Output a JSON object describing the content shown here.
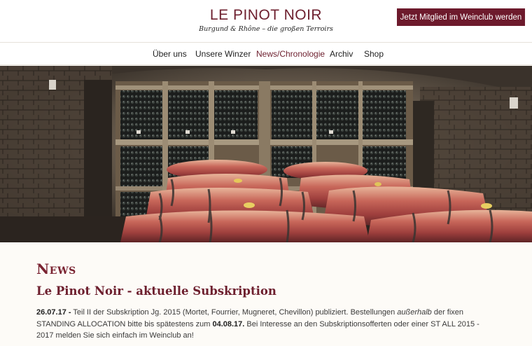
{
  "brand": {
    "title": "LE PINOT NOIR",
    "subtitle": "Burgund & Rhône – die großen Terroirs"
  },
  "header": {
    "cta_label": "Jetzt Mitglied im Weinclub werden"
  },
  "nav": {
    "items": [
      {
        "label": "Über uns"
      },
      {
        "label": "Unsere Winzer"
      },
      {
        "label": "News/Chronologie",
        "active": true
      },
      {
        "label": "Archiv"
      },
      {
        "label": "Shop"
      }
    ]
  },
  "hero": {
    "image": "wine-cellar-with-oak-barrels"
  },
  "main": {
    "section_title": "News",
    "article": {
      "title": "Le Pinot Noir - aktuelle Subskription",
      "date1": "26.07.17 -",
      "text1": " Teil II der Subskription Jg. 2015 (Mortet, Fourrier, Mugneret, Chevillon) publiziert. Bestellungen ",
      "emphasis": "außerhalb",
      "text2": " der fixen STANDING ALLOCATION bitte bis spätestens zum ",
      "date2": "04.08.17.",
      "text3": " Bei Interesse an den Subskriptionsofferten oder einer ST ALL 2015 - 2017 melden Sie sich einfach im Weinclub an!"
    }
  },
  "colors": {
    "brand": "#6d1f2e",
    "cta_bg": "#6d1a2c",
    "page_bg": "#fdfbf7"
  }
}
